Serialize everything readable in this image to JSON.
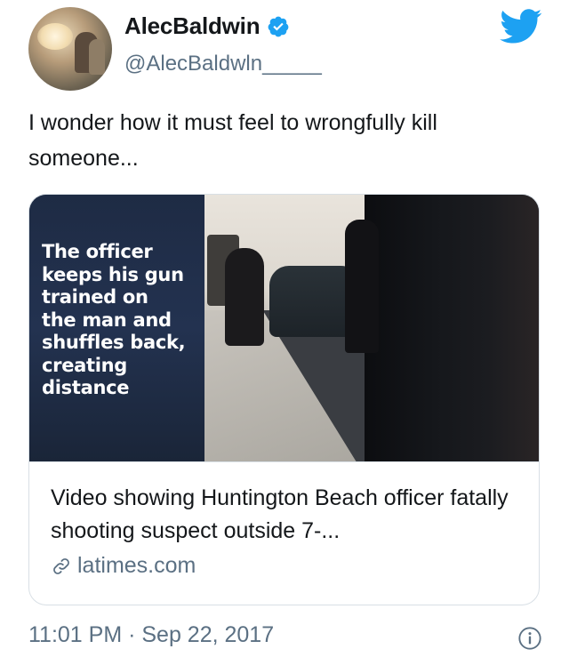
{
  "author": {
    "display_name": "AlecBaldwin",
    "handle": "@AlecBaldwln_____",
    "verified_icon": "verified-badge-icon"
  },
  "brand": {
    "icon": "twitter-bird-icon",
    "color": "#1da1f2"
  },
  "tweet": {
    "text": "I wonder how it must feel to wrongfully kill someone..."
  },
  "card": {
    "media_caption": "The officer\nkeeps his gun\ntrained on\nthe man and\nshuffles back,\ncreating\ndistance",
    "title": "Video showing Huntington Beach officer fatally shooting suspect outside 7-...",
    "domain": "latimes.com",
    "domain_icon": "link-icon"
  },
  "timestamp": "11:01 PM · Sep 22, 2017",
  "info_icon": "info-icon",
  "colors": {
    "text_primary": "#14171a",
    "text_secondary": "#5b7083",
    "border": "#d8dfe5"
  }
}
